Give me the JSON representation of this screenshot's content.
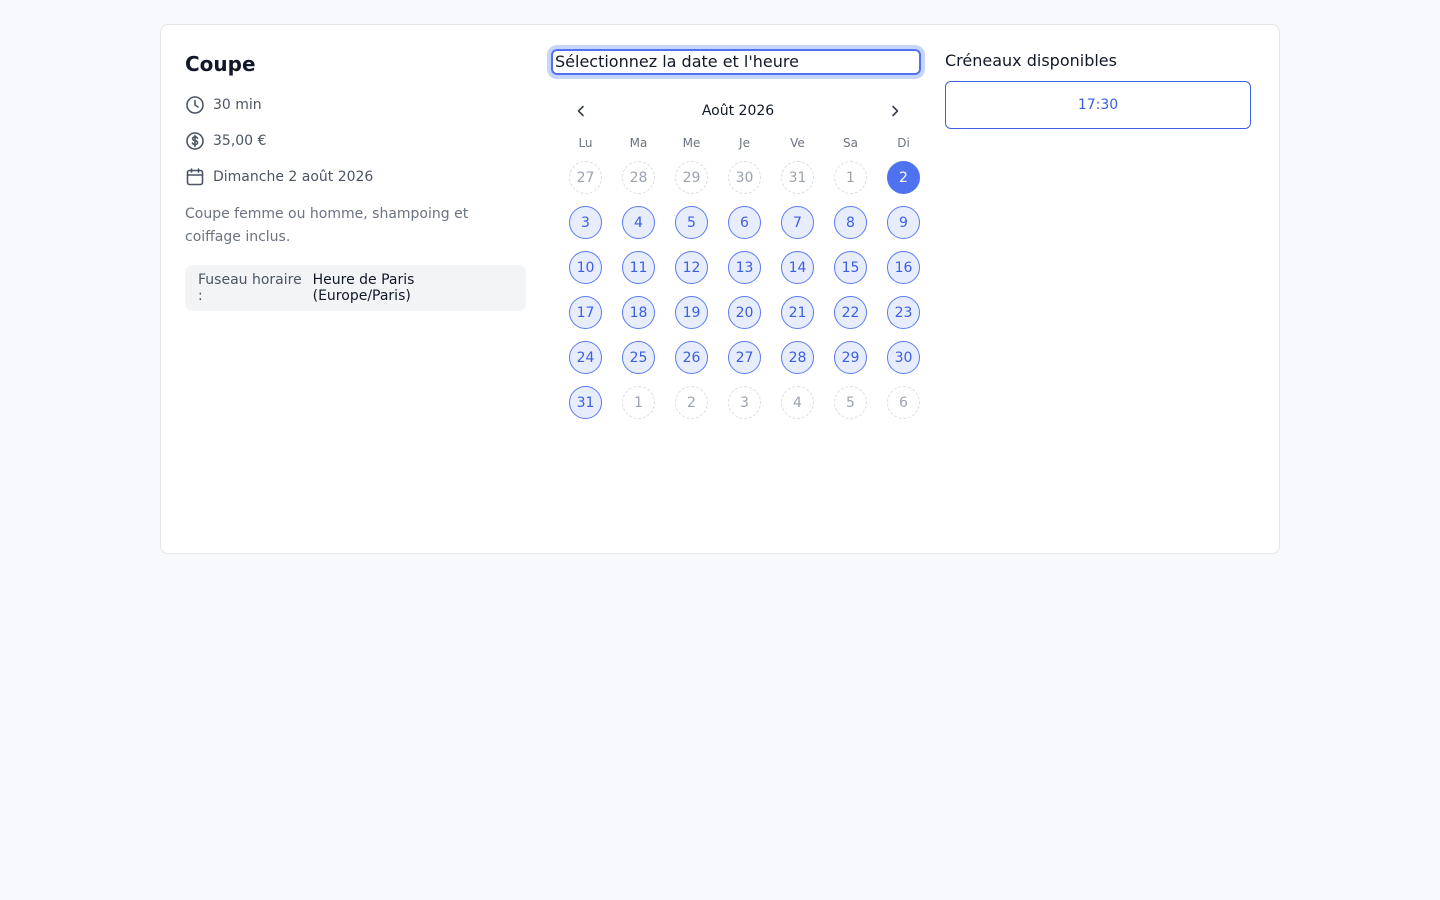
{
  "service": {
    "title": "Coupe",
    "duration": "30 min",
    "price": "35,00 €",
    "date": "Dimanche 2 août 2026",
    "description": "Coupe femme ou homme, shampoing et coiffage inclus.",
    "timezone_label": "Fuseau horaire :",
    "timezone_value": "Heure de Paris (Europe/Paris)"
  },
  "calendar": {
    "title": "Sélectionnez la date et l'heure",
    "month": "Août 2026",
    "weekdays": [
      "Lu",
      "Ma",
      "Me",
      "Je",
      "Ve",
      "Sa",
      "Di"
    ],
    "days": [
      {
        "label": "27",
        "state": "out"
      },
      {
        "label": "28",
        "state": "out"
      },
      {
        "label": "29",
        "state": "out"
      },
      {
        "label": "30",
        "state": "out"
      },
      {
        "label": "31",
        "state": "out"
      },
      {
        "label": "1",
        "state": "out"
      },
      {
        "label": "2",
        "state": "selected"
      },
      {
        "label": "3",
        "state": "available"
      },
      {
        "label": "4",
        "state": "available"
      },
      {
        "label": "5",
        "state": "available"
      },
      {
        "label": "6",
        "state": "available"
      },
      {
        "label": "7",
        "state": "available"
      },
      {
        "label": "8",
        "state": "available"
      },
      {
        "label": "9",
        "state": "available"
      },
      {
        "label": "10",
        "state": "available"
      },
      {
        "label": "11",
        "state": "available"
      },
      {
        "label": "12",
        "state": "available"
      },
      {
        "label": "13",
        "state": "available"
      },
      {
        "label": "14",
        "state": "available"
      },
      {
        "label": "15",
        "state": "available"
      },
      {
        "label": "16",
        "state": "available"
      },
      {
        "label": "17",
        "state": "available"
      },
      {
        "label": "18",
        "state": "available"
      },
      {
        "label": "19",
        "state": "available"
      },
      {
        "label": "20",
        "state": "available"
      },
      {
        "label": "21",
        "state": "available"
      },
      {
        "label": "22",
        "state": "available"
      },
      {
        "label": "23",
        "state": "available"
      },
      {
        "label": "24",
        "state": "available"
      },
      {
        "label": "25",
        "state": "available"
      },
      {
        "label": "26",
        "state": "available"
      },
      {
        "label": "27",
        "state": "available"
      },
      {
        "label": "28",
        "state": "available"
      },
      {
        "label": "29",
        "state": "available"
      },
      {
        "label": "30",
        "state": "available"
      },
      {
        "label": "31",
        "state": "available"
      },
      {
        "label": "1",
        "state": "out"
      },
      {
        "label": "2",
        "state": "out"
      },
      {
        "label": "3",
        "state": "out"
      },
      {
        "label": "4",
        "state": "out"
      },
      {
        "label": "5",
        "state": "out"
      },
      {
        "label": "6",
        "state": "out"
      }
    ]
  },
  "slots": {
    "title": "Créneaux disponibles",
    "items": [
      "17:30"
    ]
  },
  "colors": {
    "accent": "#4f73f0",
    "accent_text": "#3b5fe0",
    "available_bg": "#e7edfd"
  },
  "icons": {
    "duration": "clock-icon",
    "price": "dollar-circle-icon",
    "date": "calendar-icon",
    "prev": "chevron-left-icon",
    "next": "chevron-right-icon"
  }
}
